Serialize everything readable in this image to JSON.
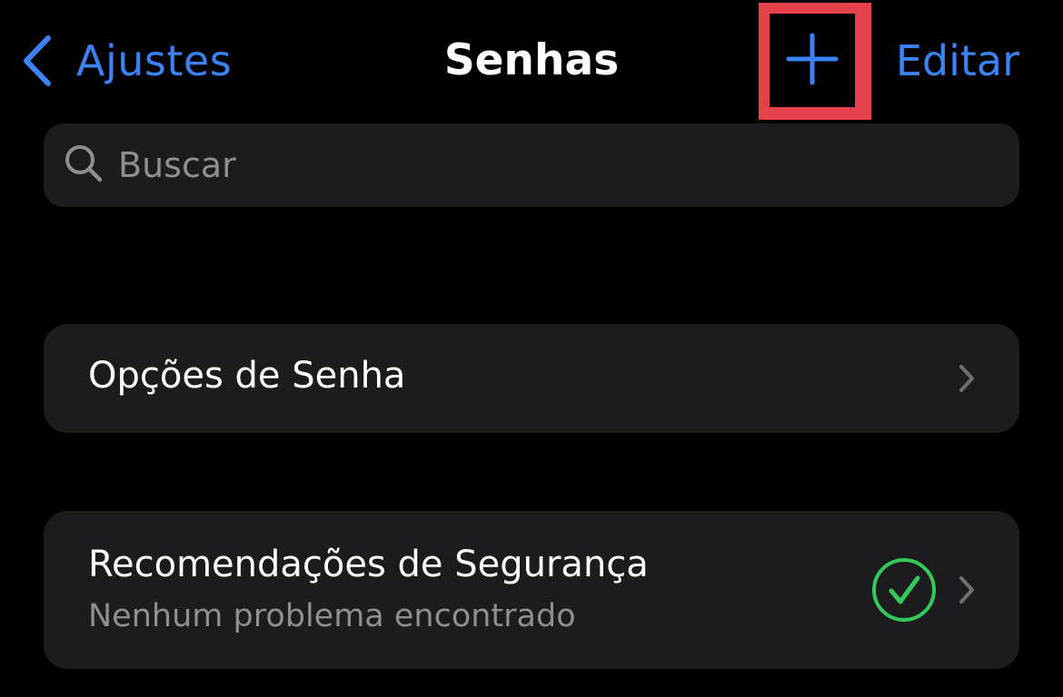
{
  "nav": {
    "back_label": "Ajustes",
    "title": "Senhas",
    "edit_label": "Editar",
    "accent_color": "#3b82f6",
    "highlight_color": "#e5414b"
  },
  "search": {
    "placeholder": "Buscar"
  },
  "rows": [
    {
      "title": "Opções de Senha",
      "icon": "chevron-right-icon"
    },
    {
      "title": "Recomendações de Segurança",
      "subtitle": "Nenhum problema encontrado",
      "status_icon": "checkmark-circle-icon",
      "status_color": "#34c759",
      "icon": "chevron-right-icon"
    }
  ]
}
